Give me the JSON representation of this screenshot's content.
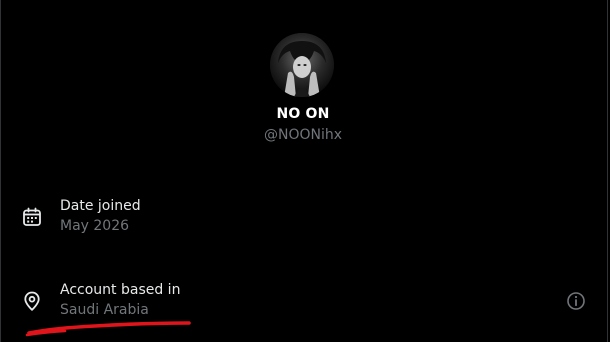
{
  "profile": {
    "display_name": "NO ON",
    "handle": "@NOONihx"
  },
  "details": {
    "date_joined_label": "Date joined",
    "date_joined_value": "May 2026",
    "account_based_label": "Account based in",
    "account_based_value": "Saudi Arabia"
  },
  "icons": {
    "calendar": "calendar-icon",
    "location": "location-pin-icon",
    "info": "info-icon"
  },
  "colors": {
    "background": "#000000",
    "primary_text": "#e7e9ea",
    "secondary_text": "#71767b",
    "annotation": "#e0151b"
  }
}
